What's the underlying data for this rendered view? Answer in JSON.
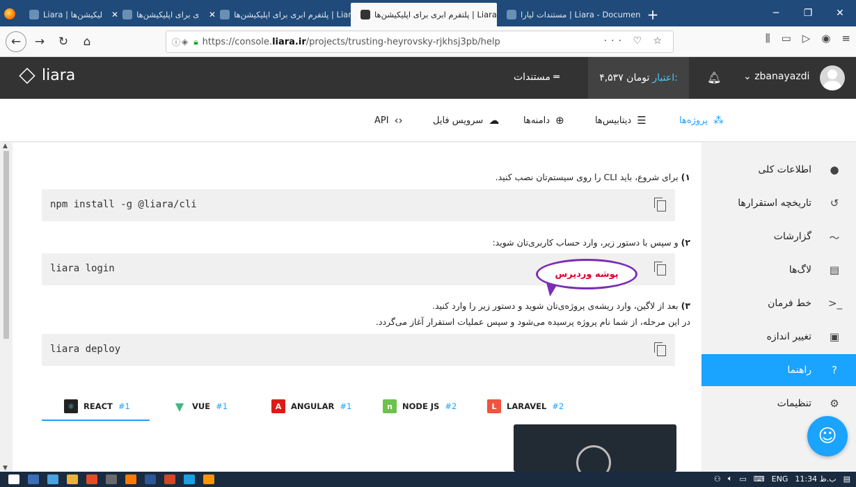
{
  "browser": {
    "tabs": [
      {
        "title": "Liara | ابری برای اپلیکیشن‌ها",
        "active": false
      },
      {
        "title": "پلتفرم ابری برای اپلیکیشن‌ها | Liara",
        "active": false
      },
      {
        "title": "پلتفرم ابری برای اپلیکیشن‌ها | Liara",
        "active": false
      },
      {
        "title": "پلتفرم ابری برای اپلیکیشن‌ها | Liara",
        "active": true
      },
      {
        "title": "مستندات لیارا | Liara - Documen",
        "active": false
      }
    ],
    "url_prefix": "https://console.",
    "url_host": "liara.ir",
    "url_path": "/projects/trusting-heyrovsky-rjkhsj3pb/help",
    "url_actions": "··· ♡ ☆"
  },
  "header": {
    "logo_text": "liara",
    "docs_label": "مستندات",
    "credit_label": "اعتبار:",
    "credit_value": "۴,۵۳۷ تومان",
    "username": "zbanayazdi"
  },
  "subnav": {
    "projects": "پروژه‌ها",
    "databases": "دیتابیس‌ها",
    "domains": "دامنه‌ها",
    "file_service": "سرویس فایل",
    "api": "API"
  },
  "sidebar": {
    "items": [
      {
        "label": "اطلاعات کلی",
        "icon": "info-icon"
      },
      {
        "label": "تاریخچه استقرارها",
        "icon": "history-icon"
      },
      {
        "label": "گزارشات",
        "icon": "chart-icon"
      },
      {
        "label": "لاگ‌ها",
        "icon": "file-icon"
      },
      {
        "label": "خط فرمان",
        "icon": "terminal-icon"
      },
      {
        "label": "تغییر اندازه",
        "icon": "chip-icon"
      },
      {
        "label": "راهنما",
        "icon": "help-icon"
      },
      {
        "label": "تنظیمات",
        "icon": "gear-icon"
      }
    ],
    "active_index": 6
  },
  "main": {
    "step1_num": "۱)",
    "step1_text": "برای شروع، باید CLI را روی سیستم‌تان نصب کنید.",
    "cmd1": "npm install -g @liara/cli",
    "step2_num": "۲)",
    "step2_text": "و سپس با دستور زیر، وارد حساب کاربری‌تان شوید:",
    "cmd2": "liara login",
    "step3_num": "۳)",
    "step3_text": "بعد از لاگین، وارد ریشه‌ی پروژه‌ی‌تان شوید و دستور زیر را وارد کنید.",
    "step3_sub": "در این مرحله، از شما نام پروژه پرسیده می‌شود و سپس عملیات استقرار آغاز می‌گردد.",
    "cmd3": "liara deploy",
    "annotation": "پوشه وردپرس"
  },
  "frameworks": [
    {
      "name": "REACT",
      "num": "#1",
      "color": "#222222"
    },
    {
      "name": "VUE",
      "num": "#1",
      "color": "#41b883"
    },
    {
      "name": "ANGULAR",
      "num": "#1",
      "color": "#dd1b16"
    },
    {
      "name": "NODE JS",
      "num": "#2",
      "color": "#6cc24a"
    },
    {
      "name": "LARAVEL",
      "num": "#2",
      "color": "#f05340"
    }
  ],
  "taskbar": {
    "lang": "ENG",
    "time": "11:34 ب.ظ"
  },
  "colors": {
    "accent": "#1aa3ff",
    "header_bg": "#333333",
    "browser_tabs_bg": "#1f4a7a"
  }
}
